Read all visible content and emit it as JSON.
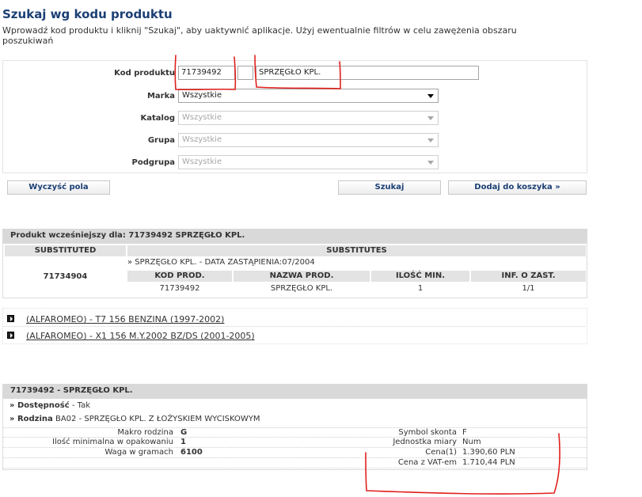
{
  "header": {
    "title": "Szukaj wg kodu produktu",
    "description": "Wprowadź kod produktu i kliknij \"Szukaj\", aby uaktywnić aplikacje. Użyj ewentualnie filtrów w celu zawężenia obszaru poszukiwań"
  },
  "form": {
    "code_label": "Kod produktu",
    "code_value": "71739492",
    "code_extra_value": "",
    "name_value": "SPRZĘGŁO KPL.",
    "marka_label": "Marka",
    "marka_value": "Wszystkie",
    "katalog_label": "Katalog",
    "katalog_value": "Wszystkie",
    "grupa_label": "Grupa",
    "grupa_value": "Wszystkie",
    "podgrupa_label": "Podgrupa",
    "podgrupa_value": "Wszystkie"
  },
  "buttons": {
    "clear": "Wyczyść pola",
    "search": "Szukaj",
    "add_to_cart": "Dodaj do koszyka  »"
  },
  "substitution": {
    "title": "Produkt wcześniejszy dla: 71739492 SPRZĘGŁO KPL.",
    "col_substituted": "SUBSTITUTED",
    "col_substitutes": "SUBSTITUTES",
    "substituted_code": "71734904",
    "substitute_line": "» SPRZĘGŁO KPL. - DATA ZASTĄPIENIA:07/2004",
    "sub_headers": [
      "KOD PROD.",
      "NAZWA PROD.",
      "ILOŚĆ MIN.",
      "INF. O ZAST."
    ],
    "sub_row": [
      "71739492",
      "SPRZĘGŁO KPL.",
      "1",
      "1/1"
    ]
  },
  "applications": [
    "(ALFAROMEO) - T7 156 BENZINA (1997-2002)",
    "(ALFAROMEO) - X1 156 M.Y.2002 BZ/DS (2001-2005)"
  ],
  "details": {
    "title": "71739492 - SPRZĘGŁO KPL.",
    "availability_label": "» Dostępność",
    "availability_value": " - Tak",
    "family_label": "» Rodzina",
    "family_value": " BA02 - SPRZĘGŁO KPL. Z ŁOŻYSKIEM WYCISKOWYM",
    "left": [
      {
        "label": "Makro rodzina",
        "value": "G"
      },
      {
        "label": "Ilość minimalna w opakowaniu",
        "value": "1"
      },
      {
        "label": "Waga w gramach",
        "value": "6100"
      }
    ],
    "right": [
      {
        "label": "Symbol skonta",
        "value": "F"
      },
      {
        "label": "Jednostka miary",
        "value": "Num"
      },
      {
        "label": "Cena(1)",
        "value": "1.390,60 PLN"
      },
      {
        "label": "Cena z VAT-em",
        "value": "1.710,44 PLN"
      }
    ]
  },
  "colors": {
    "title": "#1b3f74",
    "annotation": "#e0201c",
    "section_header": "#d9d9d9"
  }
}
